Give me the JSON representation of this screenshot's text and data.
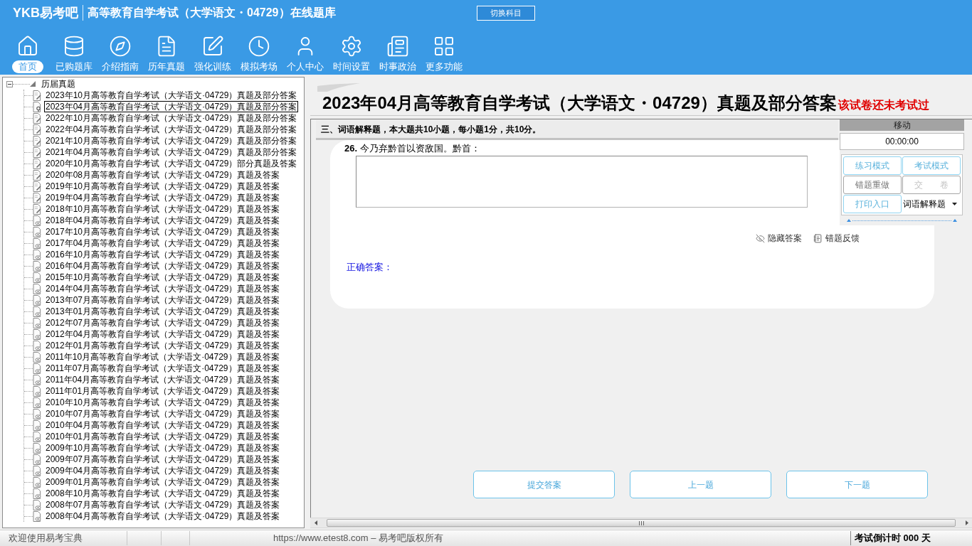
{
  "header": {
    "logo": "YKB易考吧",
    "title": "高等教育自学考试（大学语文・04729）在线题库",
    "switch_button": "切换科目"
  },
  "toolbar": [
    {
      "label": "首页",
      "kind": "home",
      "selected": true
    },
    {
      "label": "已购题库",
      "kind": "purchased",
      "selected": false
    },
    {
      "label": "介绍指南",
      "kind": "guide",
      "selected": false
    },
    {
      "label": "历年真题",
      "kind": "papers",
      "selected": false
    },
    {
      "label": "强化训练",
      "kind": "training",
      "selected": false
    },
    {
      "label": "模拟考场",
      "kind": "exam",
      "selected": false
    },
    {
      "label": "个人中心",
      "kind": "profile",
      "selected": false
    },
    {
      "label": "时间设置",
      "kind": "time",
      "selected": false
    },
    {
      "label": "时事政治",
      "kind": "news",
      "selected": false
    },
    {
      "label": "更多功能",
      "kind": "more",
      "selected": false
    }
  ],
  "tree": {
    "root": {
      "label": "历届真题",
      "expanded": true,
      "children": [
        {
          "label": "2023年10月高等教育自学考试（大学语文·04729）真题及部分答案",
          "kind": "edit",
          "selected": false
        },
        {
          "label": "2023年04月高等教育自学考试（大学语文·04729）真题及部分答案",
          "kind": "current",
          "selected": true
        },
        {
          "label": "2022年10月高等教育自学考试（大学语文·04729）真题及部分答案",
          "kind": "edit",
          "selected": false
        },
        {
          "label": "2022年04月高等教育自学考试（大学语文·04729）真题及部分答案",
          "kind": "edit",
          "selected": false
        },
        {
          "label": "2021年10月高等教育自学考试（大学语文·04729）真题及部分答案",
          "kind": "edit",
          "selected": false
        },
        {
          "label": "2021年04月高等教育自学考试（大学语文·04729）真题及部分答案",
          "kind": "edit",
          "selected": false
        },
        {
          "label": "2020年10月高等教育自学考试（大学语文·04729）部分真题及答案",
          "kind": "edit",
          "selected": false
        },
        {
          "label": "2020年08月高等教育自学考试（大学语文·04729）真题及答案",
          "kind": "edit",
          "selected": false
        },
        {
          "label": "2019年10月高等教育自学考试（大学语文·04729）真题及答案",
          "kind": "edit",
          "selected": false
        },
        {
          "label": "2019年04月高等教育自学考试（大学语文·04729）真题及答案",
          "kind": "edit",
          "selected": false
        },
        {
          "label": "2018年10月高等教育自学考试（大学语文·04729）真题及答案",
          "kind": "edit",
          "selected": false
        },
        {
          "label": "2018年04月高等教育自学考试（大学语文·04729）真题及答案",
          "kind": "view",
          "selected": false
        },
        {
          "label": "2017年10月高等教育自学考试（大学语文·04729）真题及答案",
          "kind": "view",
          "selected": false
        },
        {
          "label": "2017年04月高等教育自学考试（大学语文·04729）真题及答案",
          "kind": "view",
          "selected": false
        },
        {
          "label": "2016年10月高等教育自学考试（大学语文·04729）真题及答案",
          "kind": "view",
          "selected": false
        },
        {
          "label": "2016年04月高等教育自学考试（大学语文·04729）真题及答案",
          "kind": "view",
          "selected": false
        },
        {
          "label": "2015年10月高等教育自学考试（大学语文·04729）真题及答案",
          "kind": "view",
          "selected": false
        },
        {
          "label": "2014年04月高等教育自学考试（大学语文·04729）真题及答案",
          "kind": "view",
          "selected": false
        },
        {
          "label": "2013年07月高等教育自学考试（大学语文·04729）真题及答案",
          "kind": "view",
          "selected": false
        },
        {
          "label": "2013年01月高等教育自学考试（大学语文·04729）真题及答案",
          "kind": "view",
          "selected": false
        },
        {
          "label": "2012年07月高等教育自学考试（大学语文·04729）真题及答案",
          "kind": "view",
          "selected": false
        },
        {
          "label": "2012年04月高等教育自学考试（大学语文·04729）真题及答案",
          "kind": "view",
          "selected": false
        },
        {
          "label": "2012年01月高等教育自学考试（大学语文·04729）真题及答案",
          "kind": "view",
          "selected": false
        },
        {
          "label": "2011年10月高等教育自学考试（大学语文·04729）真题及答案",
          "kind": "view",
          "selected": false
        },
        {
          "label": "2011年07月高等教育自学考试（大学语文·04729）真题及答案",
          "kind": "view",
          "selected": false
        },
        {
          "label": "2011年04月高等教育自学考试（大学语文·04729）真题及答案",
          "kind": "view",
          "selected": false
        },
        {
          "label": "2011年01月高等教育自学考试（大学语文·04729）真题及答案",
          "kind": "view",
          "selected": false
        },
        {
          "label": "2010年10月高等教育自学考试（大学语文·04729）真题及答案",
          "kind": "view",
          "selected": false
        },
        {
          "label": "2010年07月高等教育自学考试（大学语文·04729）真题及答案",
          "kind": "view",
          "selected": false
        },
        {
          "label": "2010年04月高等教育自学考试（大学语文·04729）真题及答案",
          "kind": "view",
          "selected": false
        },
        {
          "label": "2010年01月高等教育自学考试（大学语文·04729）真题及答案",
          "kind": "view",
          "selected": false
        },
        {
          "label": "2009年10月高等教育自学考试（大学语文·04729）真题及答案",
          "kind": "view",
          "selected": false
        },
        {
          "label": "2009年07月高等教育自学考试（大学语文·04729）真题及答案",
          "kind": "view",
          "selected": false
        },
        {
          "label": "2009年04月高等教育自学考试（大学语文·04729）真题及答案",
          "kind": "view",
          "selected": false
        },
        {
          "label": "2009年01月高等教育自学考试（大学语文·04729）真题及答案",
          "kind": "view",
          "selected": false
        },
        {
          "label": "2008年10月高等教育自学考试（大学语文·04729）真题及答案",
          "kind": "view",
          "selected": false
        },
        {
          "label": "2008年07月高等教育自学考试（大学语文·04729）真题及答案",
          "kind": "view",
          "selected": false
        },
        {
          "label": "2008年04月高等教育自学考试（大学语文·04729）真题及答案",
          "kind": "view",
          "selected": false
        }
      ]
    }
  },
  "paper": {
    "title": "2023年04月高等教育自学考试（大学语文・04729）真题及部分答案",
    "status": "该试卷还未考试过"
  },
  "section": {
    "heading": "三、词语解释题，本大题共10小题，每小题1分，共10分。"
  },
  "question": {
    "text": "**26.** 今乃弃黔首以资敌国。黔首：",
    "actions": [
      {
        "label": "隐藏答案",
        "kind": "hide"
      },
      {
        "label": "错题反馈",
        "kind": "feedback"
      }
    ],
    "answer_label": "正确答案："
  },
  "control_panel": {
    "title": "移动",
    "timer": "00:00:00",
    "buttons": [
      {
        "label": "练习模式",
        "kind": "accent",
        "disabled": false
      },
      {
        "label": "考试模式",
        "kind": "accent",
        "disabled": false
      },
      {
        "label": "错题重做",
        "kind": "neutral",
        "disabled": false
      },
      {
        "label": "交　　卷",
        "kind": "neutral",
        "disabled": true
      },
      {
        "label": "打印入口",
        "kind": "accent",
        "disabled": false
      }
    ],
    "dropdown": {
      "value": "词语解释题"
    }
  },
  "nav_buttons": [
    "提交答案",
    "上一题",
    "下一题"
  ],
  "status_bar": {
    "welcome": "欢迎使用易考宝典",
    "copyright": "https://www.etest8.com – 易考吧版权所有",
    "countdown": "考试倒计时 000 天"
  }
}
